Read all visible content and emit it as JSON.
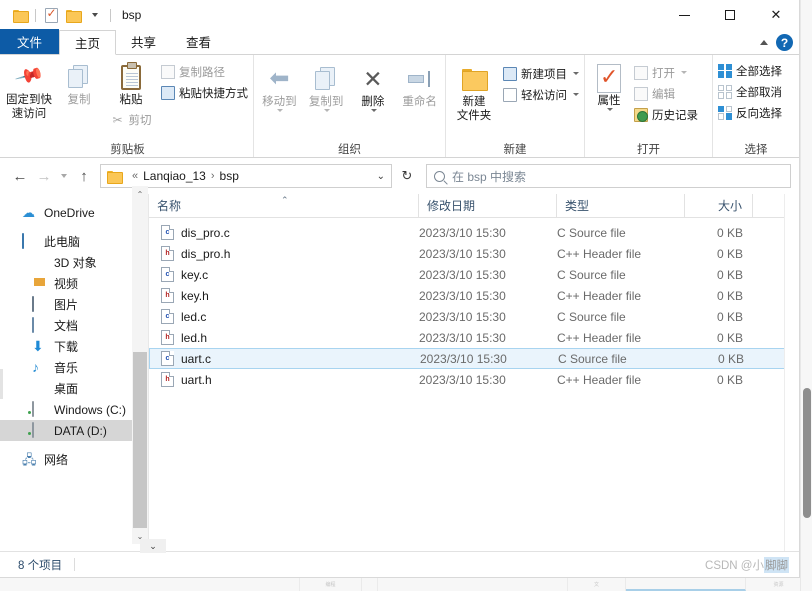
{
  "window": {
    "title": "bsp",
    "quick_access": [
      {
        "name": "folder-icon",
        "label": ""
      },
      {
        "name": "properties-icon",
        "label": ""
      },
      {
        "name": "new-folder-icon",
        "label": ""
      },
      {
        "name": "chevron-down-icon",
        "label": ""
      }
    ],
    "controls": {
      "minimize": "—",
      "maximize": "□",
      "close": "✕"
    }
  },
  "tabs": [
    {
      "id": "file",
      "label": "文件"
    },
    {
      "id": "home",
      "label": "主页"
    },
    {
      "id": "share",
      "label": "共享"
    },
    {
      "id": "view",
      "label": "查看"
    }
  ],
  "ribbon": {
    "collapse_icon": "chevron-up-icon",
    "help_label": "?",
    "groups": [
      {
        "id": "clipboard",
        "label": "剪贴板",
        "big": [
          {
            "label": "固定到快\n速访问",
            "icon": "pin-icon",
            "dim": false
          },
          {
            "label": "复制",
            "icon": "copy-icon",
            "dim": true
          },
          {
            "label": "粘贴",
            "icon": "paste-icon",
            "dim": false
          }
        ],
        "small": [
          {
            "label": "复制路径",
            "icon": "copy-path-icon",
            "dim": true
          },
          {
            "label": "粘贴快捷方式",
            "icon": "paste-shortcut-icon",
            "dim": false
          },
          {
            "label": "剪切",
            "icon": "scissors-icon",
            "dim": true
          }
        ]
      },
      {
        "id": "organize",
        "label": "组织",
        "big": [
          {
            "label": "移动到",
            "icon": "move-to-icon",
            "dim": true,
            "dropdown": true
          },
          {
            "label": "复制到",
            "icon": "copy-to-icon",
            "dim": true,
            "dropdown": true
          },
          {
            "label": "删除",
            "icon": "delete-icon",
            "dim": false,
            "dropdown": true
          },
          {
            "label": "重命名",
            "icon": "rename-icon",
            "dim": true
          }
        ]
      },
      {
        "id": "new",
        "label": "新建",
        "big": [
          {
            "label": "新建\n文件夹",
            "icon": "new-folder-icon",
            "dim": false
          }
        ],
        "small": [
          {
            "label": "新建项目",
            "icon": "new-item-icon",
            "dim": false,
            "dropdown": true
          },
          {
            "label": "轻松访问",
            "icon": "easy-access-icon",
            "dim": false,
            "dropdown": true
          }
        ]
      },
      {
        "id": "open",
        "label": "打开",
        "big": [
          {
            "label": "属性",
            "icon": "properties-icon",
            "dim": false,
            "dropdown": true
          }
        ],
        "small": [
          {
            "label": "打开",
            "icon": "open-icon",
            "dim": true,
            "dropdown": true
          },
          {
            "label": "编辑",
            "icon": "edit-icon",
            "dim": true
          },
          {
            "label": "历史记录",
            "icon": "history-icon",
            "dim": false
          }
        ]
      },
      {
        "id": "select",
        "label": "选择",
        "small": [
          {
            "label": "全部选择",
            "icon": "select-all-icon",
            "dim": false
          },
          {
            "label": "全部取消",
            "icon": "select-none-icon",
            "dim": false
          },
          {
            "label": "反向选择",
            "icon": "invert-selection-icon",
            "dim": false
          }
        ]
      }
    ]
  },
  "addressbar": {
    "back_icon": "arrow-left-icon",
    "forward_icon": "arrow-right-icon",
    "recent_icon": "chevron-down-icon",
    "up_icon": "arrow-up-icon",
    "refresh_icon": "refresh-icon",
    "breadcrumb_prefix": "«",
    "breadcrumbs": [
      "Lanqiao_13",
      "bsp"
    ],
    "breadcrumb_separator": "›",
    "dropdown_icon": "chevron-down-icon"
  },
  "search": {
    "icon": "search-icon",
    "placeholder": "在 bsp 中搜索",
    "value": ""
  },
  "navpane": {
    "items": [
      {
        "label": "OneDrive",
        "icon": "onedrive-cloud-icon",
        "indent": 0,
        "selected": false,
        "gap_before": false
      },
      {
        "label": "此电脑",
        "icon": "this-pc-icon",
        "indent": 0,
        "selected": false,
        "gap_before": true
      },
      {
        "label": "3D 对象",
        "icon": "3d-objects-icon",
        "indent": 1,
        "selected": false,
        "gap_before": false
      },
      {
        "label": "视频",
        "icon": "videos-icon",
        "indent": 1,
        "selected": false,
        "gap_before": false
      },
      {
        "label": "图片",
        "icon": "pictures-icon",
        "indent": 1,
        "selected": false,
        "gap_before": false
      },
      {
        "label": "文档",
        "icon": "documents-icon",
        "indent": 1,
        "selected": false,
        "gap_before": false
      },
      {
        "label": "下载",
        "icon": "downloads-icon",
        "indent": 1,
        "selected": false,
        "gap_before": false
      },
      {
        "label": "音乐",
        "icon": "music-icon",
        "indent": 1,
        "selected": false,
        "gap_before": false
      },
      {
        "label": "桌面",
        "icon": "desktop-icon",
        "indent": 1,
        "selected": false,
        "gap_before": false
      },
      {
        "label": "Windows (C:)",
        "icon": "drive-c-icon",
        "indent": 1,
        "selected": false,
        "gap_before": false
      },
      {
        "label": "DATA (D:)",
        "icon": "drive-d-icon",
        "indent": 1,
        "selected": true,
        "gap_before": false
      },
      {
        "label": "网络",
        "icon": "network-icon",
        "indent": 0,
        "selected": false,
        "gap_before": true
      }
    ]
  },
  "filelist": {
    "columns": [
      {
        "key": "name",
        "label": "名称",
        "sorted": true,
        "sort_icon": "chevron-up-icon"
      },
      {
        "key": "date",
        "label": "修改日期"
      },
      {
        "key": "type",
        "label": "类型"
      },
      {
        "key": "size",
        "label": "大小"
      }
    ],
    "rows": [
      {
        "name": "dis_pro.c",
        "date": "2023/3/10 15:30",
        "type": "C Source file",
        "size": "0 KB",
        "icon": "c-file-icon",
        "ext": "c",
        "selected": false
      },
      {
        "name": "dis_pro.h",
        "date": "2023/3/10 15:30",
        "type": "C++ Header file",
        "size": "0 KB",
        "icon": "h-file-icon",
        "ext": "h",
        "selected": false
      },
      {
        "name": "key.c",
        "date": "2023/3/10 15:30",
        "type": "C Source file",
        "size": "0 KB",
        "icon": "c-file-icon",
        "ext": "c",
        "selected": false
      },
      {
        "name": "key.h",
        "date": "2023/3/10 15:30",
        "type": "C++ Header file",
        "size": "0 KB",
        "icon": "h-file-icon",
        "ext": "h",
        "selected": false
      },
      {
        "name": "led.c",
        "date": "2023/3/10 15:30",
        "type": "C Source file",
        "size": "0 KB",
        "icon": "c-file-icon",
        "ext": "c",
        "selected": false
      },
      {
        "name": "led.h",
        "date": "2023/3/10 15:30",
        "type": "C++ Header file",
        "size": "0 KB",
        "icon": "h-file-icon",
        "ext": "h",
        "selected": false
      },
      {
        "name": "uart.c",
        "date": "2023/3/10 15:30",
        "type": "C Source file",
        "size": "0 KB",
        "icon": "c-file-icon",
        "ext": "c",
        "selected": true
      },
      {
        "name": "uart.h",
        "date": "2023/3/10 15:30",
        "type": "C++ Header file",
        "size": "0 KB",
        "icon": "h-file-icon",
        "ext": "h",
        "selected": false
      }
    ]
  },
  "statusbar": {
    "item_count": "8 个项目",
    "collapse_icon": "chevron-down-icon"
  },
  "watermark": {
    "prefix": "CSDN @小",
    "name": "脚脚"
  },
  "colors": {
    "accent": "#0d5ba6",
    "selection_fill": "#eaf4fc",
    "selection_border": "#a8d4f0",
    "nav_selected": "#d6d6d6",
    "column_header_text": "#39536e",
    "folder_yellow": "#fbc757"
  }
}
